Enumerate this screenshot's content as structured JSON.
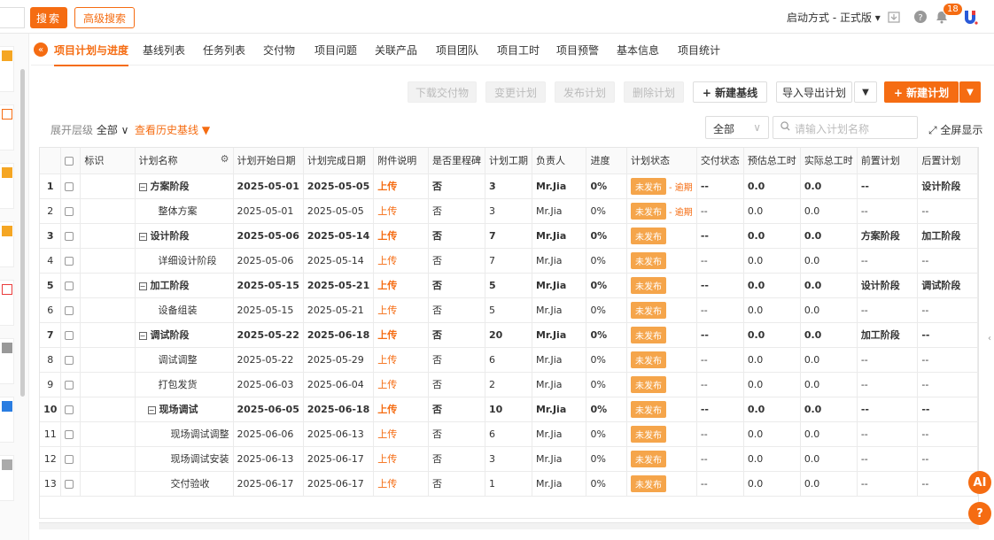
{
  "topbar": {
    "search_label": "搜索",
    "advanced_label": "高级搜索",
    "boot_mode": "启动方式 - 正式版 ▾",
    "notification_count": "18"
  },
  "tabs": [
    "项目计划与进度",
    "基线列表",
    "任务列表",
    "交付物",
    "项目问题",
    "关联产品",
    "项目团队",
    "项目工时",
    "项目预警",
    "基本信息",
    "项目统计"
  ],
  "actions": {
    "download_deliverables": "下载交付物",
    "change_plan": "变更计划",
    "publish_plan": "发布计划",
    "delete_plan": "删除计划",
    "new_baseline": "+ 新建基线",
    "import_export": "导入导出计划",
    "new_plan": "+ 新建计划"
  },
  "filter": {
    "expand_level_label": "展开层级",
    "expand_level_value": "全部 ∨",
    "history_baseline": "查看历史基线 ▼",
    "scope_select": "全部",
    "search_placeholder": "请输入计划名称",
    "fullscreen": "全屏显示"
  },
  "table": {
    "columns": [
      "",
      "",
      "标识",
      "计划名称",
      "计划开始日期",
      "计划完成日期",
      "附件说明",
      "是否里程碑",
      "计划工期",
      "负责人",
      "进度",
      "计划状态",
      "交付状态",
      "预估总工时",
      "实际总工时",
      "前置计划",
      "后置计划"
    ],
    "rows": [
      {
        "no": "1",
        "name": "方案阶段",
        "start": "2025-05-01",
        "end": "2025-05-05",
        "attach": "上传",
        "milestone": "否",
        "duration": "3",
        "owner": "Mr.Jia",
        "progress": "0%",
        "status": "未发布",
        "overdue": "- 逾期",
        "delivery": "--",
        "est": "0.0",
        "actual": "0.0",
        "pre": "--",
        "post": "设计阶段",
        "phase": true,
        "level": 0
      },
      {
        "no": "2",
        "name": "整体方案",
        "start": "2025-05-01",
        "end": "2025-05-05",
        "attach": "上传",
        "milestone": "否",
        "duration": "3",
        "owner": "Mr.Jia",
        "progress": "0%",
        "status": "未发布",
        "overdue": "- 逾期",
        "delivery": "--",
        "est": "0.0",
        "actual": "0.0",
        "pre": "--",
        "post": "--",
        "phase": false,
        "level": 1
      },
      {
        "no": "3",
        "name": "设计阶段",
        "start": "2025-05-06",
        "end": "2025-05-14",
        "attach": "上传",
        "milestone": "否",
        "duration": "7",
        "owner": "Mr.Jia",
        "progress": "0%",
        "status": "未发布",
        "overdue": "",
        "delivery": "--",
        "est": "0.0",
        "actual": "0.0",
        "pre": "方案阶段",
        "post": "加工阶段",
        "phase": true,
        "level": 0
      },
      {
        "no": "4",
        "name": "详细设计阶段",
        "start": "2025-05-06",
        "end": "2025-05-14",
        "attach": "上传",
        "milestone": "否",
        "duration": "7",
        "owner": "Mr.Jia",
        "progress": "0%",
        "status": "未发布",
        "overdue": "",
        "delivery": "--",
        "est": "0.0",
        "actual": "0.0",
        "pre": "--",
        "post": "--",
        "phase": false,
        "level": 1
      },
      {
        "no": "5",
        "name": "加工阶段",
        "start": "2025-05-15",
        "end": "2025-05-21",
        "attach": "上传",
        "milestone": "否",
        "duration": "5",
        "owner": "Mr.Jia",
        "progress": "0%",
        "status": "未发布",
        "overdue": "",
        "delivery": "--",
        "est": "0.0",
        "actual": "0.0",
        "pre": "设计阶段",
        "post": "调试阶段",
        "phase": true,
        "level": 0
      },
      {
        "no": "6",
        "name": "设备组装",
        "start": "2025-05-15",
        "end": "2025-05-21",
        "attach": "上传",
        "milestone": "否",
        "duration": "5",
        "owner": "Mr.Jia",
        "progress": "0%",
        "status": "未发布",
        "overdue": "",
        "delivery": "--",
        "est": "0.0",
        "actual": "0.0",
        "pre": "--",
        "post": "--",
        "phase": false,
        "level": 1
      },
      {
        "no": "7",
        "name": "调试阶段",
        "start": "2025-05-22",
        "end": "2025-06-18",
        "attach": "上传",
        "milestone": "否",
        "duration": "20",
        "owner": "Mr.Jia",
        "progress": "0%",
        "status": "未发布",
        "overdue": "",
        "delivery": "--",
        "est": "0.0",
        "actual": "0.0",
        "pre": "加工阶段",
        "post": "--",
        "phase": true,
        "level": 0
      },
      {
        "no": "8",
        "name": "调试调整",
        "start": "2025-05-22",
        "end": "2025-05-29",
        "attach": "上传",
        "milestone": "否",
        "duration": "6",
        "owner": "Mr.Jia",
        "progress": "0%",
        "status": "未发布",
        "overdue": "",
        "delivery": "--",
        "est": "0.0",
        "actual": "0.0",
        "pre": "--",
        "post": "--",
        "phase": false,
        "level": 1
      },
      {
        "no": "9",
        "name": "打包发货",
        "start": "2025-06-03",
        "end": "2025-06-04",
        "attach": "上传",
        "milestone": "否",
        "duration": "2",
        "owner": "Mr.Jia",
        "progress": "0%",
        "status": "未发布",
        "overdue": "",
        "delivery": "--",
        "est": "0.0",
        "actual": "0.0",
        "pre": "--",
        "post": "--",
        "phase": false,
        "level": 1
      },
      {
        "no": "10",
        "name": "现场调试",
        "start": "2025-06-05",
        "end": "2025-06-18",
        "attach": "上传",
        "milestone": "否",
        "duration": "10",
        "owner": "Mr.Jia",
        "progress": "0%",
        "status": "未发布",
        "overdue": "",
        "delivery": "--",
        "est": "0.0",
        "actual": "0.0",
        "pre": "--",
        "post": "--",
        "phase": true,
        "level": 1
      },
      {
        "no": "11",
        "name": "现场调试调整",
        "start": "2025-06-06",
        "end": "2025-06-13",
        "attach": "上传",
        "milestone": "否",
        "duration": "6",
        "owner": "Mr.Jia",
        "progress": "0%",
        "status": "未发布",
        "overdue": "",
        "delivery": "--",
        "est": "0.0",
        "actual": "0.0",
        "pre": "--",
        "post": "--",
        "phase": false,
        "level": 2
      },
      {
        "no": "12",
        "name": "现场调试安装",
        "start": "2025-06-13",
        "end": "2025-06-17",
        "attach": "上传",
        "milestone": "否",
        "duration": "3",
        "owner": "Mr.Jia",
        "progress": "0%",
        "status": "未发布",
        "overdue": "",
        "delivery": "--",
        "est": "0.0",
        "actual": "0.0",
        "pre": "--",
        "post": "--",
        "phase": false,
        "level": 2
      },
      {
        "no": "13",
        "name": "交付验收",
        "start": "2025-06-17",
        "end": "2025-06-17",
        "attach": "上传",
        "milestone": "否",
        "duration": "1",
        "owner": "Mr.Jia",
        "progress": "0%",
        "status": "未发布",
        "overdue": "",
        "delivery": "--",
        "est": "0.0",
        "actual": "0.0",
        "pre": "--",
        "post": "--",
        "phase": false,
        "level": 2
      }
    ]
  },
  "colors": {
    "accent": "#f56c12",
    "status_badge": "#f5a54b"
  }
}
